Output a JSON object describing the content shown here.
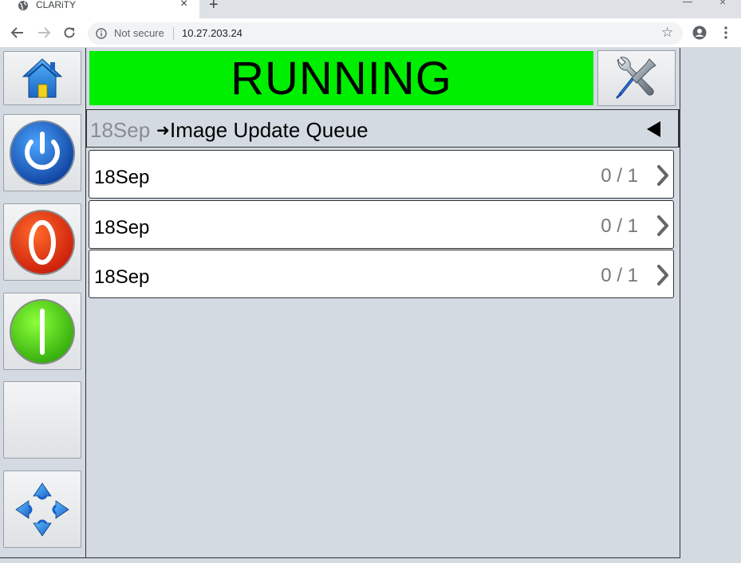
{
  "browser": {
    "tab_title": "CLARiTY",
    "tab_close": "×",
    "new_tab": "+",
    "security_label": "Not secure",
    "url": "10.27.203.24",
    "star": "☆",
    "window_close": "×"
  },
  "status": {
    "text": "RUNNING",
    "color": "#00ee00"
  },
  "breadcrumb": {
    "parent": "18Sep",
    "separator": "➜",
    "current": "Image Update Queue"
  },
  "queue": {
    "rows": [
      {
        "name": "18Sep",
        "count": "0 / 1"
      },
      {
        "name": "18Sep",
        "count": "0 / 1"
      },
      {
        "name": "18Sep",
        "count": "0 / 1"
      }
    ]
  },
  "icons": {
    "home": "home-icon",
    "tools": "tools-icon",
    "power": "power-icon",
    "stop": "stop-icon",
    "start": "start-icon",
    "navigate": "navigation-arrows-icon"
  }
}
